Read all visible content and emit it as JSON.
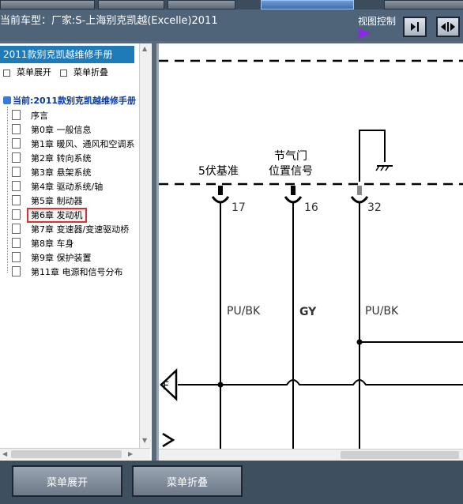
{
  "header": {
    "vehicle_label": "当前车型：厂家:S-上海别克凯越(Excelle)2011",
    "view_control_label": "视图控制"
  },
  "sidebar": {
    "title": "2011款别克凯越维修手册",
    "expand_label": "菜单展开",
    "collapse_label": "菜单折叠",
    "root_label": "当前:2011款别克凯越维修手册",
    "items": [
      {
        "label": "序言"
      },
      {
        "label": "第0章 一般信息"
      },
      {
        "label": "第1章 暖风、通风和空调系"
      },
      {
        "label": "第2章 转向系统"
      },
      {
        "label": "第3章 悬架系统"
      },
      {
        "label": "第4章 驱动系统/轴"
      },
      {
        "label": "第5章 制动器"
      },
      {
        "label": "第6章 发动机"
      },
      {
        "label": "第7章 变速器/变速驱动桥"
      },
      {
        "label": "第8章 车身"
      },
      {
        "label": "第9章 保护装置"
      },
      {
        "label": "第11章 电源和信号分布"
      }
    ],
    "selected_index": 7
  },
  "diagram": {
    "labels": {
      "ref5v": "5伏基准",
      "throttle_line1": "节气门",
      "throttle_line2": "位置信号",
      "pin17": "17",
      "pin16": "16",
      "pin32": "32",
      "wire1": "PU/BK",
      "wire2": "GY",
      "wire3": "PU/BK",
      "connector_f": "F"
    }
  },
  "footer": {
    "expand_button": "菜单展开",
    "collapse_button": "菜单折叠"
  }
}
